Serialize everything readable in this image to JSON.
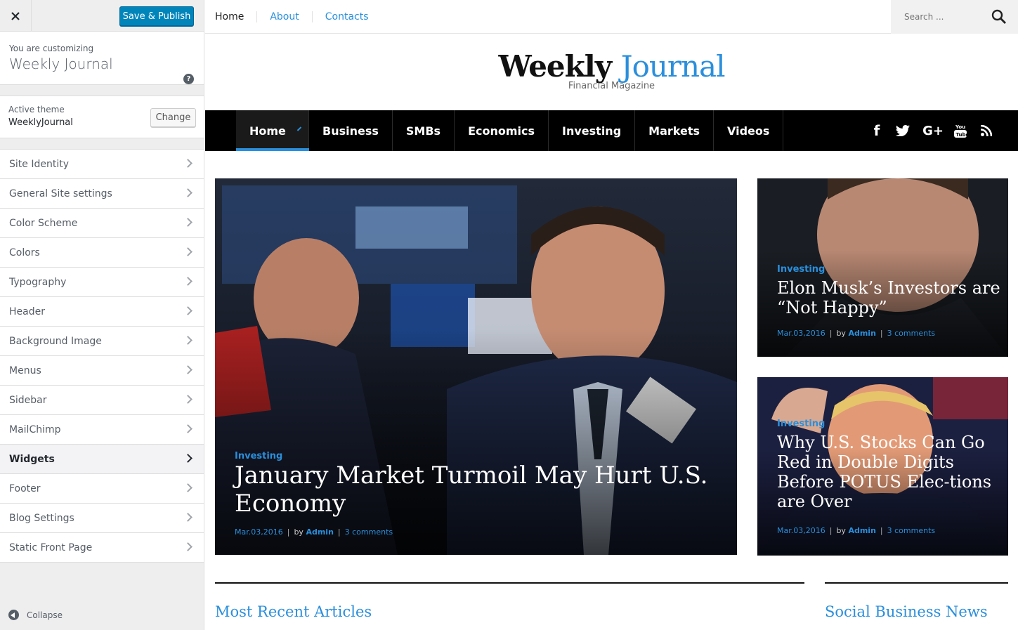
{
  "customizer": {
    "save_label": "Save & Publish",
    "customizing_label": "You are customizing",
    "site_name": "Weekly Journal",
    "active_theme_label": "Active theme",
    "active_theme_name": "WeeklyJournal",
    "change_label": "Change",
    "sections": [
      {
        "label": "Site Identity"
      },
      {
        "label": "General Site settings"
      },
      {
        "label": "Color Scheme"
      },
      {
        "label": "Colors"
      },
      {
        "label": "Typography"
      },
      {
        "label": "Header"
      },
      {
        "label": "Background Image"
      },
      {
        "label": "Menus"
      },
      {
        "label": "Sidebar"
      },
      {
        "label": "MailChimp"
      },
      {
        "label": "Widgets"
      },
      {
        "label": "Footer"
      },
      {
        "label": "Blog Settings"
      },
      {
        "label": "Static Front Page"
      }
    ],
    "collapse_label": "Collapse"
  },
  "site": {
    "top_nav": [
      "Home",
      "About",
      "Contacts"
    ],
    "search_placeholder": "Search ...",
    "logo_word1": "Weekly",
    "logo_word2": "Journal",
    "tagline": "Financial Magazine",
    "main_nav": [
      "Home",
      "Business",
      "SMBs",
      "Economics",
      "Investing",
      "Markets",
      "Videos"
    ],
    "social_icons": [
      "facebook-icon",
      "twitter-icon",
      "google-plus-icon",
      "youtube-icon",
      "rss-icon"
    ],
    "featured": {
      "category": "Investing",
      "title": "January Market Turmoil May Hurt U.S. Economy",
      "date": "Mar.03,2016",
      "by": "by",
      "author": "Admin",
      "comments": "3 comments"
    },
    "side1": {
      "category": "Investing",
      "title": "Elon Musk’s Investors are “Not Happy”",
      "date": "Mar.03,2016",
      "by": "by",
      "author": "Admin",
      "comments": "3 comments"
    },
    "side2": {
      "category": "Investing",
      "title": "Why U.S. Stocks Can Go Red in Double Digits Before POTUS Elec-tions are Over",
      "date": "Mar.03,2016",
      "by": "by",
      "author": "Admin",
      "comments": "3 comments"
    },
    "section_recent": "Most Recent Articles",
    "section_social": "Social Business News"
  },
  "colors": {
    "accent": "#2a8fdc",
    "wp_primary": "#0085ba",
    "nav_bg": "#000000"
  }
}
